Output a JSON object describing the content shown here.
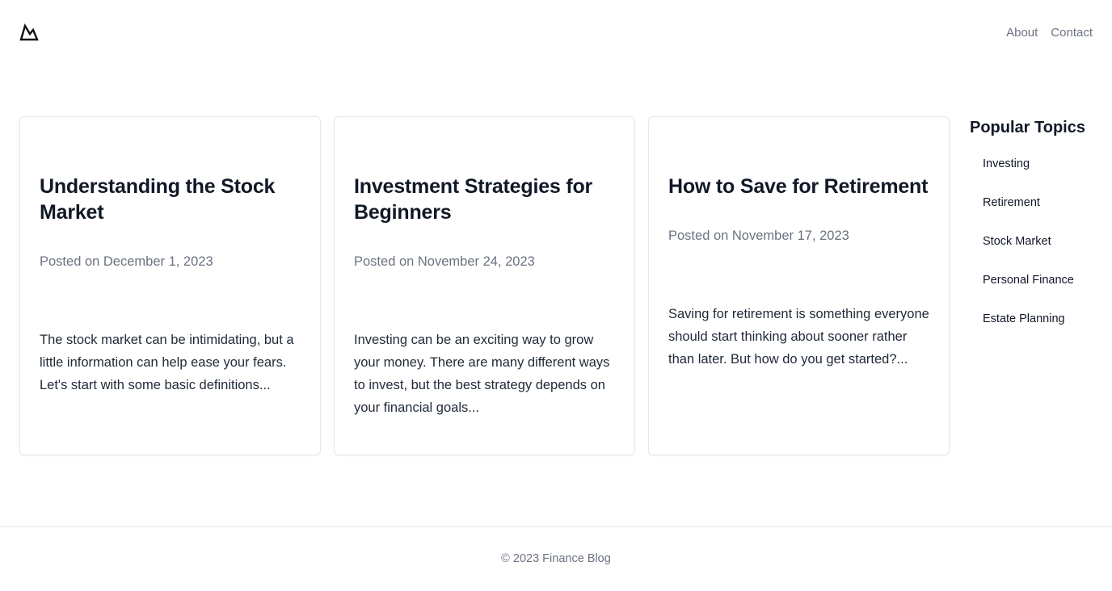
{
  "header": {
    "logo_icon": "mountain-logo-icon",
    "nav": [
      {
        "label": "About"
      },
      {
        "label": "Contact"
      }
    ]
  },
  "posts": [
    {
      "title": "Understanding the Stock Market",
      "date": "Posted on December 1, 2023",
      "excerpt": "The stock market can be intimidating, but a little information can help ease your fears. Let's start with some basic definitions..."
    },
    {
      "title": "Investment Strategies for Beginners",
      "date": "Posted on November 24, 2023",
      "excerpt": "Investing can be an exciting way to grow your money. There are many different ways to invest, but the best strategy depends on your financial goals..."
    },
    {
      "title": "How to Save for Retirement",
      "date": "Posted on November 17, 2023",
      "excerpt": "Saving for retirement is something everyone should start thinking about sooner rather than later. But how do you get started?..."
    }
  ],
  "sidebar": {
    "title": "Popular Topics",
    "topics": [
      "Investing",
      "Retirement",
      "Stock Market",
      "Personal Finance",
      "Estate Planning"
    ]
  },
  "footer": {
    "text": "© 2023 Finance Blog"
  }
}
